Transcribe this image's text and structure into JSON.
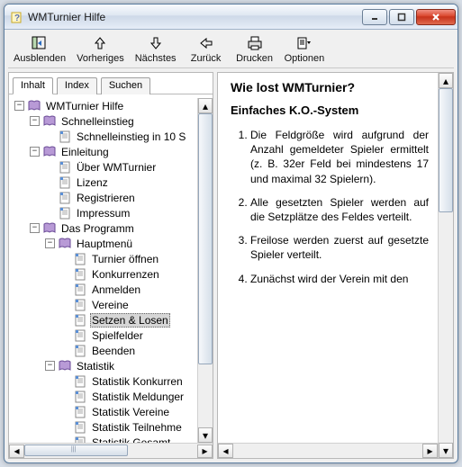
{
  "window": {
    "title": "WMTurnier Hilfe"
  },
  "toolbar": {
    "hide": "Ausblenden",
    "prev": "Vorheriges",
    "next": "Nächstes",
    "back": "Zurück",
    "print": "Drucken",
    "options": "Optionen"
  },
  "tabs": {
    "contents": "Inhalt",
    "index": "Index",
    "search": "Suchen"
  },
  "tree": {
    "root": "WMTurnier Hilfe",
    "quickstart": "Schnelleinstieg",
    "quickstart_10": "Schnelleinstieg in 10 S",
    "intro": "Einleitung",
    "about": "Über WMTurnier",
    "license": "Lizenz",
    "register": "Registrieren",
    "imprint": "Impressum",
    "program": "Das Programm",
    "mainmenu": "Hauptmenü",
    "open_tournament": "Turnier öffnen",
    "competitions": "Konkurrenzen",
    "signup": "Anmelden",
    "clubs": "Vereine",
    "seed_draw": "Setzen & Losen",
    "fields": "Spielfelder",
    "quit": "Beenden",
    "stats": "Statistik",
    "stats_comp": "Statistik Konkurren",
    "stats_reg": "Statistik Meldunger",
    "stats_clubs": "Statistik Vereine",
    "stats_part": "Statistik Teilnehme",
    "stats_total": "Statistik Gesamt"
  },
  "content": {
    "h1": "Wie lost WMTurnier?",
    "h2": "Einfaches K.O.-System",
    "li1": "Die Feldgröße wird aufgrund der Anzahl gemeldeter Spieler ermittelt (z. B. 32er Feld bei mindestens 17 und maximal 32 Spielern).",
    "li2": "Alle gesetzten Spieler werden auf die Setzplätze des Feldes verteilt.",
    "li3": "Freilose werden zuerst auf gesetzte Spieler verteilt.",
    "li4": "Zunächst wird der Verein mit den"
  }
}
